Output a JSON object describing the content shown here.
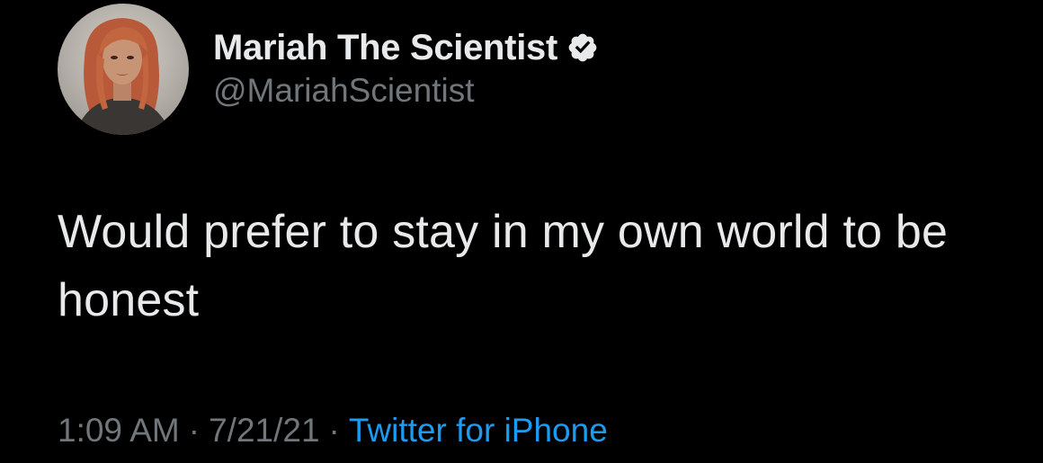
{
  "author": {
    "display_name": "Mariah The Scientist",
    "handle": "@MariahScientist",
    "verified": true,
    "avatar_icon": "profile-photo"
  },
  "tweet": {
    "text": "Would prefer to stay in my own world to be honest"
  },
  "meta": {
    "time": "1:09 AM",
    "separator": "·",
    "date": "7/21/21",
    "source": "Twitter for iPhone"
  },
  "colors": {
    "background": "#000000",
    "text": "#e7e9ea",
    "muted": "#71767b",
    "link": "#1d9bf0"
  }
}
